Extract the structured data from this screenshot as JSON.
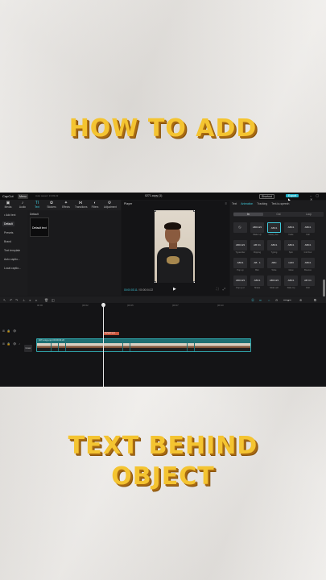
{
  "overlay": {
    "headline_top": "HOW TO ADD",
    "headline_bottom_line1": "TEXT BEHIND",
    "headline_bottom_line2": "OBJECT",
    "text_color": "#f4c431",
    "shadow_color": "#a86a12"
  },
  "app": {
    "logo": "CapCut",
    "menu_label": "Menu",
    "autosave": "Auto saved: 13:03:22",
    "project_title": "0271.copy (1)",
    "shortcut_label": "Shortcut",
    "export_label": "Export",
    "accent_color": "#3fc7d8"
  },
  "toolbar": {
    "tools": [
      {
        "icon": "media-icon",
        "glyph": "▣",
        "label": "Media"
      },
      {
        "icon": "audio-icon",
        "glyph": "♪",
        "label": "Audio"
      },
      {
        "icon": "text-icon",
        "glyph": "TI",
        "label": "Text"
      },
      {
        "icon": "stickers-icon",
        "glyph": "✿",
        "label": "Stickers"
      },
      {
        "icon": "effects-icon",
        "glyph": "✦",
        "label": "Effects"
      },
      {
        "icon": "transitions-icon",
        "glyph": "⋈",
        "label": "Transitions"
      },
      {
        "icon": "filters-icon",
        "glyph": "◐",
        "label": "Filters"
      },
      {
        "icon": "adjustment-icon",
        "glyph": "⚙",
        "label": "Adjustment"
      }
    ],
    "active_index": 2
  },
  "leftnav": {
    "items": [
      "• Add text",
      "Default",
      "Presets",
      "Brand",
      "Text template",
      "Auto captio...",
      "Local captio..."
    ],
    "selected_index": 1
  },
  "assets": {
    "tab_label": "Default",
    "tile_label": "Default text"
  },
  "player": {
    "header": "Player",
    "current_time": "00:00:03:11",
    "total_time": "00:00:04:22"
  },
  "inspector": {
    "tabs": [
      "Text",
      "Animation",
      "Tracking",
      "Text-to-speech"
    ],
    "active_tab": 1,
    "sub_tabs": [
      "In",
      "Out",
      "Loop"
    ],
    "active_sub_tab": 0,
    "cells": [
      {
        "text": "⃠",
        "caption": ""
      },
      {
        "text": "ABC123",
        "caption": "Wake Up"
      },
      {
        "text": "ABC1",
        "caption": "Heavy Sw..."
      },
      {
        "text": "ABC1",
        "caption": "Fade"
      },
      {
        "text": "ABC1",
        "caption": "Fall"
      },
      {
        "text": "ABC123",
        "caption": "Typewriter"
      },
      {
        "text": "AB C1",
        "caption": "Flipping"
      },
      {
        "text": "ABC1",
        "caption": "Typing"
      },
      {
        "text": "ABC1",
        "caption": "Spin"
      },
      {
        "text": "ABC1",
        "caption": "Ink Pour"
      },
      {
        "text": "ABC1",
        "caption": "Pop up"
      },
      {
        "text": "AB · 1",
        "caption": "Blur"
      },
      {
        "text": "ABC",
        "caption": "Write"
      },
      {
        "text": "1223",
        "caption": "Glow"
      },
      {
        "text": "ABC1",
        "caption": "Bounce"
      },
      {
        "text": "ABC123",
        "caption": "Pop up 2"
      },
      {
        "text": "ABC1",
        "caption": "Shake"
      },
      {
        "text": "ABC123",
        "caption": "Slide Left"
      },
      {
        "text": "ABC1",
        "caption": "Slide Up"
      },
      {
        "text": "AB C1",
        "caption": "Roll"
      }
    ],
    "selected_cell": 2,
    "duration_label": "Dur"
  },
  "timeline": {
    "ruler_ticks": [
      "00:00",
      "|00:02",
      "|00:05",
      "|00:07",
      "|00:10"
    ],
    "text_clip_label": "Default text",
    "video_clip_label": "0271.copy.mp4  00:00:04:22",
    "cover_label": "Cover",
    "thumb_count": 31
  }
}
